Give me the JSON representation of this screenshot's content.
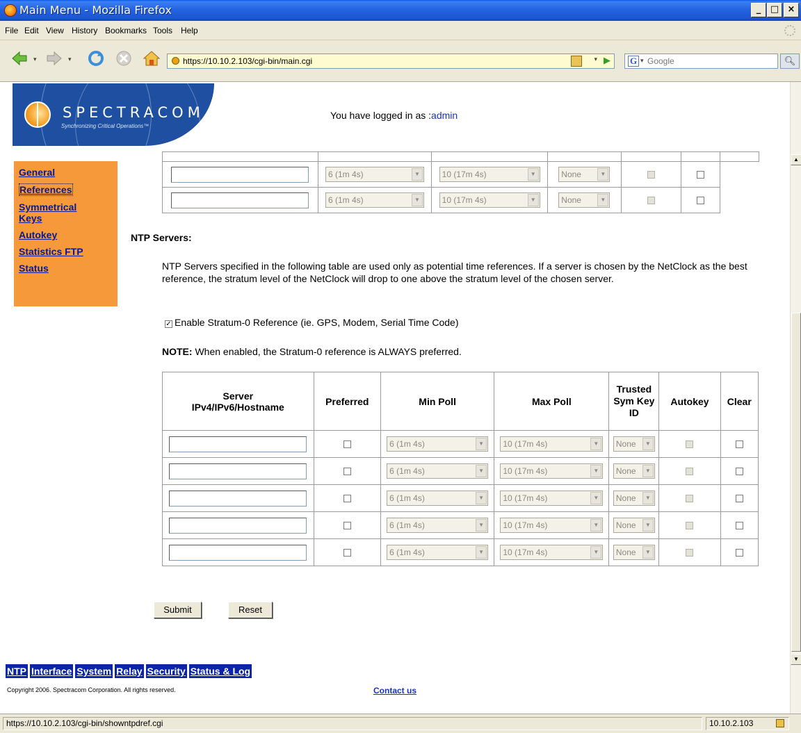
{
  "window": {
    "title": "Main Menu - Mozilla Firefox",
    "min": "_",
    "max": "□",
    "close": "×"
  },
  "menu": [
    "File",
    "Edit",
    "View",
    "History",
    "Bookmarks",
    "Tools",
    "Help"
  ],
  "address": {
    "url": "https://10.10.2.103/cgi-bin/main.cgi",
    "search_placeholder": "Google",
    "search_engine_letter": "G"
  },
  "logo": {
    "name": "SPECTRACOM",
    "tagline": "Synchronizing Critical Operations™"
  },
  "login": {
    "prefix": "You have logged in as :",
    "user": "admin"
  },
  "sidebar": {
    "items": [
      "General",
      "References",
      "Symmetrical Keys",
      "Autokey",
      "Statistics FTP",
      "Status"
    ],
    "active": "References"
  },
  "top_table_rows": [
    {
      "min": "6 (1m 4s)",
      "max": "10 (17m 4s)",
      "key": "None"
    },
    {
      "min": "6 (1m 4s)",
      "max": "10 (17m 4s)",
      "key": "None"
    }
  ],
  "ntp": {
    "heading": "NTP Servers:",
    "description": "NTP Servers specified in the following table are used only as potential time references. If a server is chosen by the NetClock as the best reference, the stratum level of the NetClock will drop to one above the stratum level of the chosen server.",
    "stratum_label": "Enable Stratum-0 Reference (ie. GPS, Modem, Serial Time Code)",
    "stratum_checked": true,
    "note_label": "NOTE:",
    "note_text": " When enabled, the Stratum-0 reference is ALWAYS preferred.",
    "columns": {
      "server": "Server IPv4/IPv6/Hostname",
      "preferred": "Preferred",
      "min_poll": "Min Poll",
      "max_poll": "Max Poll",
      "trusted": "Trusted Sym Key ID",
      "autokey": "Autokey",
      "clear": "Clear"
    },
    "rows": [
      {
        "server": "",
        "min": "6 (1m 4s)",
        "max": "10 (17m 4s)",
        "key": "None"
      },
      {
        "server": "",
        "min": "6 (1m 4s)",
        "max": "10 (17m 4s)",
        "key": "None"
      },
      {
        "server": "",
        "min": "6 (1m 4s)",
        "max": "10 (17m 4s)",
        "key": "None"
      },
      {
        "server": "",
        "min": "6 (1m 4s)",
        "max": "10 (17m 4s)",
        "key": "None"
      },
      {
        "server": "",
        "min": "6 (1m 4s)",
        "max": "10 (17m 4s)",
        "key": "None"
      }
    ]
  },
  "buttons": {
    "submit": "Submit",
    "reset": "Reset"
  },
  "bottom_nav": [
    "NTP",
    "Interface",
    "System",
    "Relay",
    "Security",
    "Status & Log"
  ],
  "footer": {
    "copyright": "Copyright 2006. Spectracom Corporation. All rights reserved.",
    "contact": "Contact us"
  },
  "status": {
    "url": "https://10.10.2.103/cgi-bin/showntpdref.cgi",
    "host": "10.10.2.103"
  }
}
